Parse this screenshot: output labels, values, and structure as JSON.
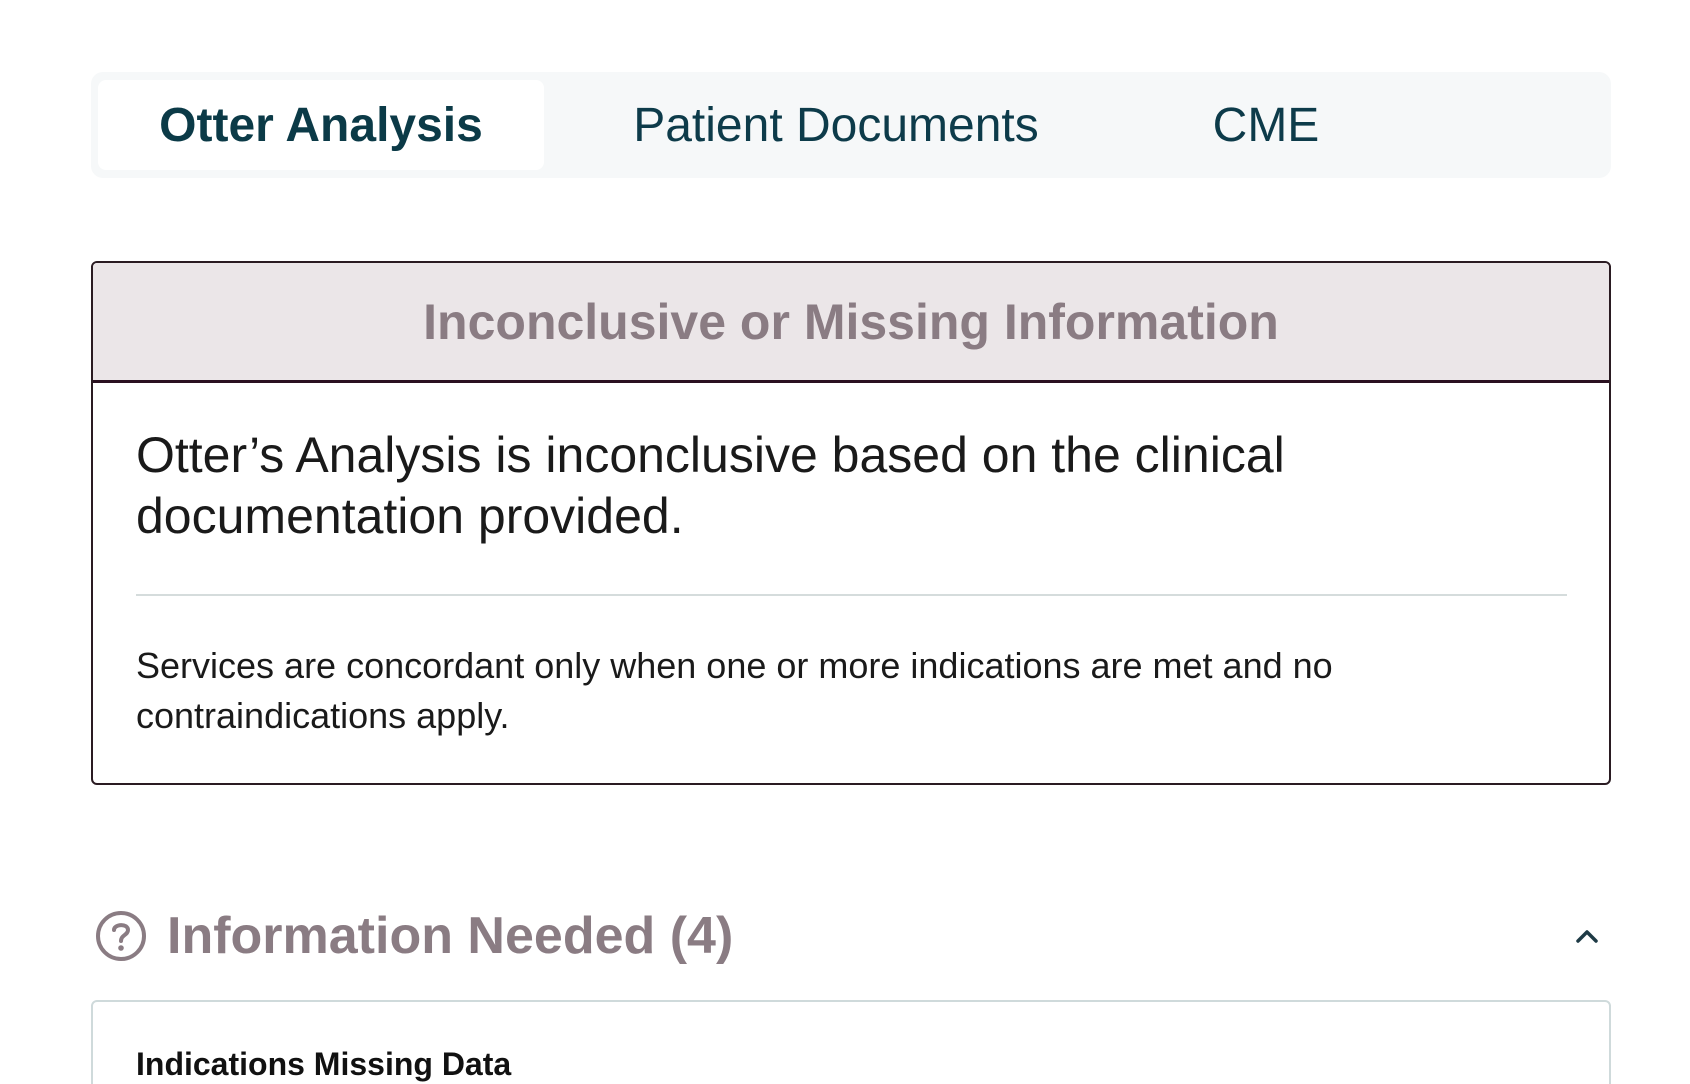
{
  "tabs": {
    "items": [
      {
        "label": "Otter Analysis",
        "active": true
      },
      {
        "label": "Patient Documents",
        "active": false
      },
      {
        "label": "CME",
        "active": false
      }
    ]
  },
  "status_card": {
    "header": "Inconclusive or Missing Information",
    "message": "Otter’s Analysis is inconclusive based on the clinical documentation provided.",
    "note": "Services are concordant only when one or more indications are met and no contraindications apply."
  },
  "information_needed": {
    "title": "Information Needed (4)",
    "icon": "question-circle-icon",
    "toggle_icon": "chevron-up-icon",
    "card": {
      "title": "Indications Missing Data"
    }
  },
  "colors": {
    "tab_text": "#0d3b4a",
    "tab_bar_bg": "#f6f8f9",
    "status_header_bg": "#ebe6e8",
    "status_header_text": "#8a7c83",
    "status_border": "#2a1b22"
  }
}
